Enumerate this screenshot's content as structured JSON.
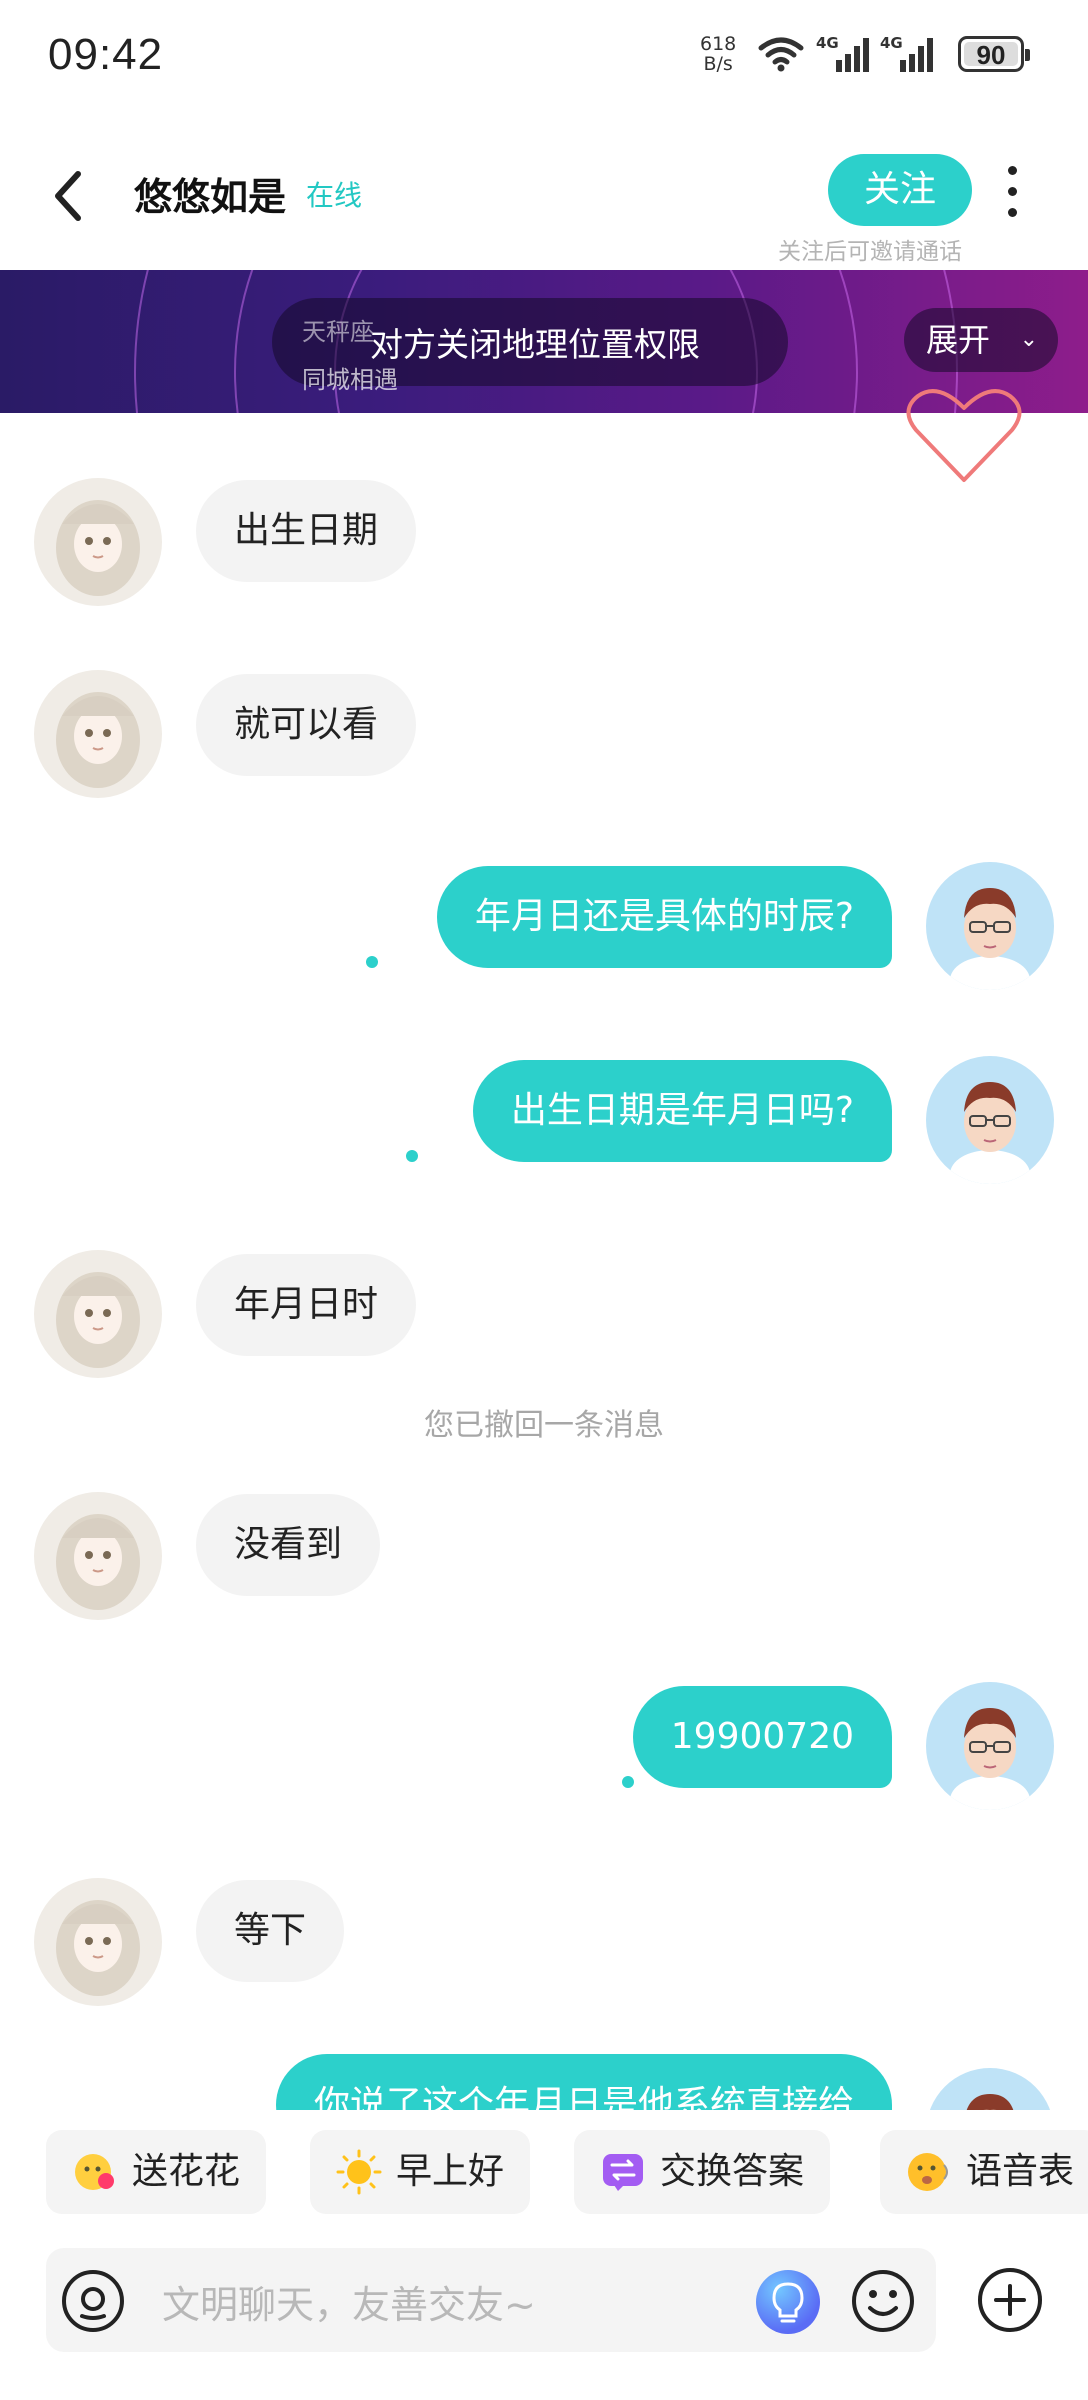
{
  "status_bar": {
    "time": "09:42",
    "net_speed_value": "618",
    "net_speed_unit": "B/s",
    "battery": "90"
  },
  "header": {
    "name": "悠悠如是",
    "online": "在线",
    "follow_label": "关注",
    "follow_hint": "关注后可邀请通话"
  },
  "banner": {
    "zodiac": "天秤座",
    "city_label": "同城相遇",
    "location_notice": "对方关闭地理位置权限",
    "expand_label": "展开"
  },
  "messages": [
    {
      "side": "in",
      "text": "出生日期"
    },
    {
      "side": "in",
      "text": "就可以看"
    },
    {
      "side": "out",
      "text": "年月日还是具体的时辰?"
    },
    {
      "side": "out",
      "text": "出生日期是年月日吗?"
    },
    {
      "side": "in",
      "text": "年月日时"
    },
    {
      "side": "system",
      "text": "您已撤回一条消息"
    },
    {
      "side": "in",
      "text": "没看到"
    },
    {
      "side": "out",
      "text": "19900720"
    },
    {
      "side": "in",
      "text": "等下"
    },
    {
      "side": "out",
      "text": "你说了这个年月日是他系统直接给"
    }
  ],
  "quick_replies": [
    {
      "label": "送花花",
      "icon": "flower-face-icon"
    },
    {
      "label": "早上好",
      "icon": "sun-icon"
    },
    {
      "label": "交换答案",
      "icon": "exchange-icon"
    },
    {
      "label": "语音表",
      "icon": "voice-emoji-icon"
    }
  ],
  "input": {
    "placeholder": "文明聊天，友善交友~"
  },
  "colors": {
    "accent": "#2cd0cb",
    "incoming_bubble": "#f3f3f3",
    "banner_start": "#2a1b66",
    "banner_end": "#8e1d8b"
  }
}
